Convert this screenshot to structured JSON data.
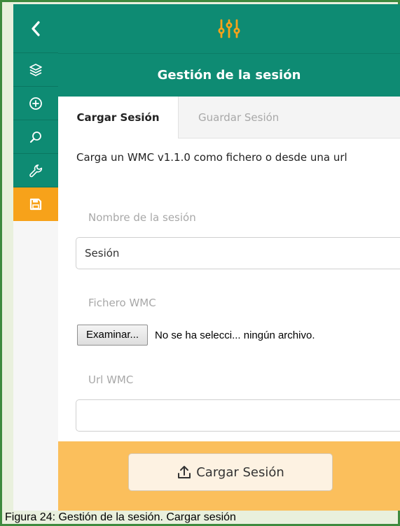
{
  "panel": {
    "title": "Gestión de la sesión"
  },
  "sidebar": {
    "items": [
      {
        "icon": "chevron-left-icon"
      },
      {
        "icon": "layers-icon"
      },
      {
        "icon": "add-circle-icon"
      },
      {
        "icon": "search-icon"
      },
      {
        "icon": "wrench-icon"
      },
      {
        "icon": "save-icon",
        "active": true
      }
    ]
  },
  "tabs": [
    {
      "label": "Cargar Sesión",
      "active": true
    },
    {
      "label": "Guardar Sesión",
      "active": false
    }
  ],
  "form": {
    "description": "Carga un WMC v1.1.0 como fichero o desde una url",
    "session_name_label": "Nombre de la sesión",
    "session_name_value": "Sesión",
    "file_label": "Fichero WMC",
    "file_button": "Examinar...",
    "file_status": "No se ha selecci... ningún archivo.",
    "url_label": "Url WMC",
    "url_value": ""
  },
  "footer": {
    "load_button": "Cargar Sesión"
  },
  "caption": "Figura 24: Gestión de la sesión. Cargar sesión",
  "colors": {
    "primary": "#0e8b73",
    "accent": "#f7a21a",
    "footer": "#fbbf5c",
    "frame": "#3e8a3e"
  }
}
